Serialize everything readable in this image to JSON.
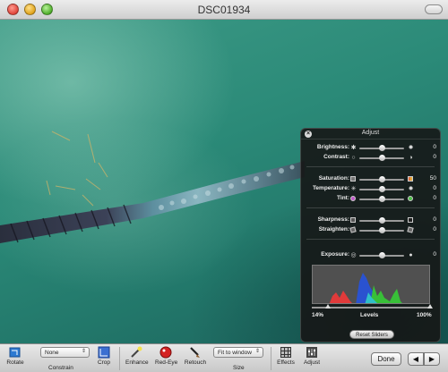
{
  "window": {
    "title": "DSC01934"
  },
  "adjust": {
    "title": "Adjust",
    "groups": [
      {
        "key": "light",
        "rows": [
          {
            "label": "Brightness:",
            "value": "0",
            "level": 0.5,
            "icon_left": "sun-small-icon",
            "icon_right": "sun-large-icon"
          },
          {
            "label": "Contrast:",
            "value": "0",
            "level": 0.5,
            "icon_left": "circle-outline-icon",
            "icon_right": "half-circle-icon"
          }
        ]
      },
      {
        "key": "color",
        "rows": [
          {
            "label": "Saturation:",
            "value": "50",
            "level": 0.5,
            "icon_left": "saturation-low-icon",
            "icon_right": "saturation-high-icon"
          },
          {
            "label": "Temperature:",
            "value": "0",
            "level": 0.5,
            "icon_left": "snowflake-icon",
            "icon_right": "sun-warm-icon"
          },
          {
            "label": "Tint:",
            "value": "0",
            "level": 0.5,
            "icon_left": "magenta-dot-icon",
            "icon_right": "green-dot-icon"
          }
        ]
      },
      {
        "key": "detail",
        "rows": [
          {
            "label": "Sharpness:",
            "value": "0",
            "level": 0.5,
            "icon_left": "soft-square-icon",
            "icon_right": "sharp-square-icon"
          },
          {
            "label": "Straighten:",
            "value": "0",
            "level": 0.5,
            "icon_left": "landscape-tilt-icon",
            "icon_right": "landscape-icon"
          }
        ]
      },
      {
        "key": "exposure",
        "rows": [
          {
            "label": "Exposure:",
            "value": "0",
            "level": 0.5,
            "icon_left": "aperture-small-icon",
            "icon_right": "aperture-large-icon"
          }
        ]
      }
    ],
    "levels": {
      "left_value": "14%",
      "label": "Levels",
      "right_value": "100%",
      "left_level": 0.14,
      "right_level": 1.0
    },
    "reset_label": "Reset Sliders"
  },
  "toolbar": {
    "rotate": {
      "label": "Rotate",
      "icon": "rotate-icon"
    },
    "constrain": {
      "label": "Constrain",
      "value": "None"
    },
    "crop": {
      "label": "Crop",
      "icon": "crop-icon"
    },
    "enhance": {
      "label": "Enhance",
      "icon": "magic-wand-icon"
    },
    "redeye": {
      "label": "Red-Eye",
      "icon": "red-eye-icon"
    },
    "retouch": {
      "label": "Retouch",
      "icon": "brush-icon"
    },
    "size": {
      "label": "Size",
      "value": "Fit to window"
    },
    "effects": {
      "label": "Effects",
      "icon": "effects-grid-icon"
    },
    "adjust": {
      "label": "Adjust",
      "icon": "adjust-sliders-icon"
    },
    "done_label": "Done",
    "prev_icon": "arrow-left-icon",
    "next_icon": "arrow-right-icon"
  }
}
